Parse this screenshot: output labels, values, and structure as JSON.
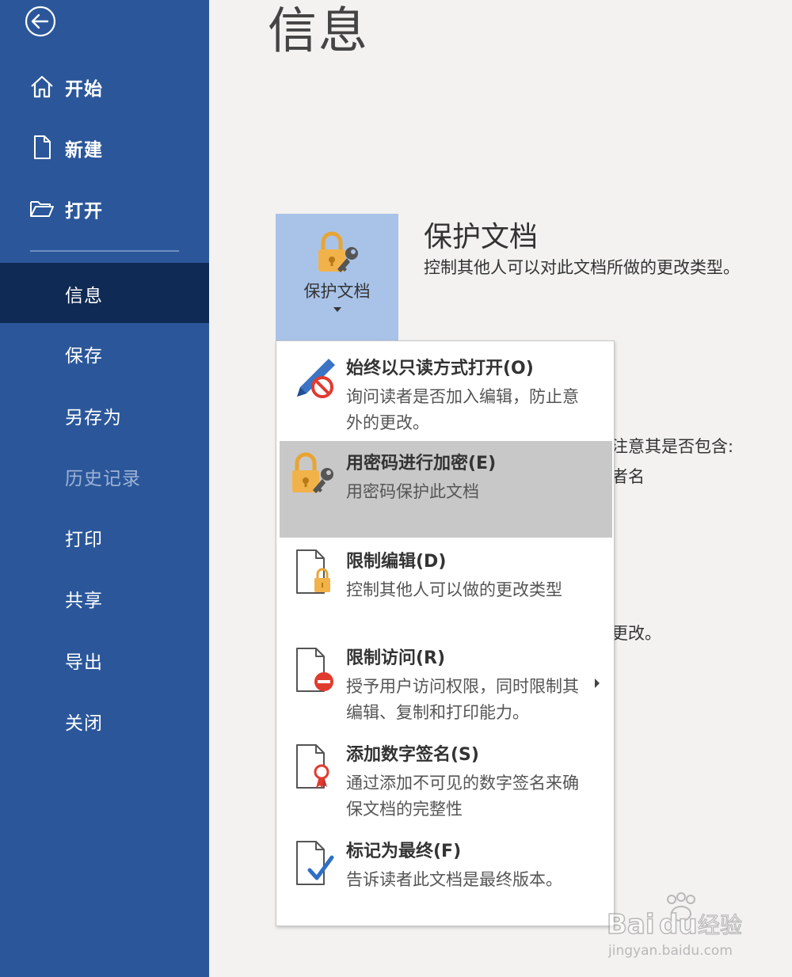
{
  "sidebar": {
    "top_items": [
      {
        "label": "开始",
        "icon": "home-icon"
      },
      {
        "label": "新建",
        "icon": "new-document-icon"
      },
      {
        "label": "打开",
        "icon": "open-folder-icon"
      }
    ],
    "items": [
      {
        "label": "信息",
        "state": "active"
      },
      {
        "label": "保存",
        "state": "normal"
      },
      {
        "label": "另存为",
        "state": "normal"
      },
      {
        "label": "历史记录",
        "state": "disabled"
      },
      {
        "label": "打印",
        "state": "normal"
      },
      {
        "label": "共享",
        "state": "normal"
      },
      {
        "label": "导出",
        "state": "normal"
      },
      {
        "label": "关闭",
        "state": "normal"
      }
    ]
  },
  "main": {
    "title": "信息",
    "protect_button": {
      "label": "保护文档",
      "icon": "lock-key-icon"
    },
    "section_title": "保护文档",
    "section_desc": "控制其他人可以对此文档所做的更改类型。",
    "obscured_fragments": [
      "注意其是否包含:",
      "者名",
      "更改。"
    ]
  },
  "menu": {
    "items": [
      {
        "title": "始终以只读方式打开(O)",
        "desc": "询问读者是否加入编辑，防止意外的更改。",
        "icon": "no-edit-pencil-icon"
      },
      {
        "title": "用密码进行加密(E)",
        "desc": "用密码保护此文档",
        "icon": "lock-key-icon"
      },
      {
        "title": "限制编辑(D)",
        "desc": "控制其他人可以做的更改类型",
        "icon": "document-lock-icon"
      },
      {
        "title": "限制访问(R)",
        "desc": "授予用户访问权限，同时限制其编辑、复制和打印能力。",
        "icon": "document-restrict-icon"
      },
      {
        "title": "添加数字签名(S)",
        "desc": "通过添加不可见的数字签名来确保文档的完整性",
        "icon": "document-ribbon-icon"
      },
      {
        "title": "标记为最终(F)",
        "desc": "告诉读者此文档是最终版本。",
        "icon": "document-check-icon"
      }
    ]
  },
  "watermark": {
    "brand": "Baidu经验",
    "url": "jingyan.baidu.com"
  },
  "colors": {
    "sidebar": "#2b579a",
    "sidebar_active": "#0f2a54",
    "highlight": "#c8c8c8",
    "accent_lock": "#f2b24a",
    "accent_red": "#e03b2f"
  }
}
